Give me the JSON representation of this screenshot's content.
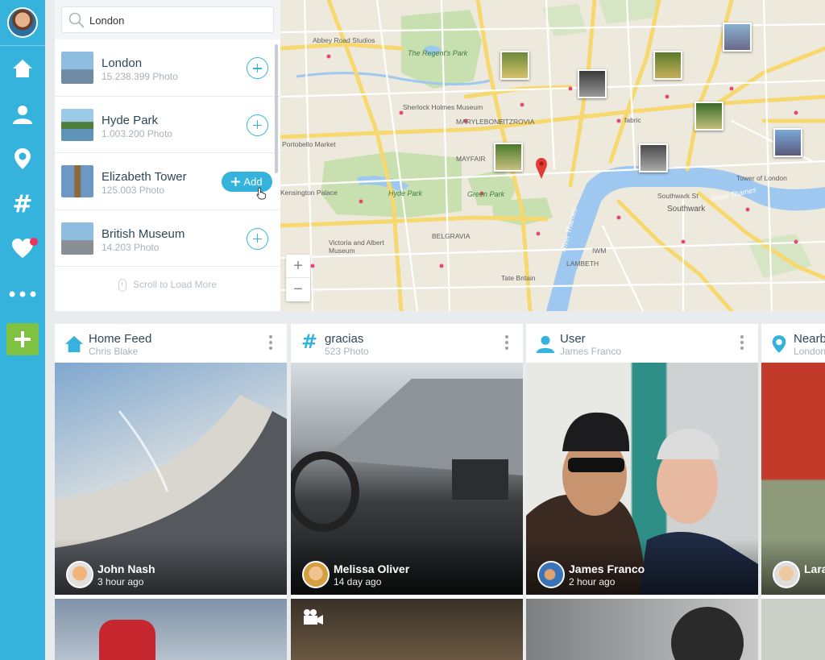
{
  "search": {
    "value": "London",
    "results": [
      {
        "title": "London",
        "count": "15.238.399 Photo"
      },
      {
        "title": "Hyde Park",
        "count": "1.003.200 Photo"
      },
      {
        "title": "Elizabeth Tower",
        "count": "125.003 Photo",
        "action": "Add"
      },
      {
        "title": "British Museum",
        "count": "14.203 Photo"
      }
    ],
    "load_more": "Scroll to Load More"
  },
  "map": {
    "labels": {
      "abbey": "Abbey Road Studios",
      "regents": "The Regent's Park",
      "marylebone": "MARYLEBONE",
      "fitzrovia": "FITZROVIA",
      "sherlock": "Sherlock Holmes Museum",
      "mayfair": "MAYFAIR",
      "hyde": "Hyde Park",
      "green": "Green Park",
      "kensington": "Kensington Palace",
      "belgravia": "BELGRAVIA",
      "va": "Victoria and Albert Museum",
      "lambeth": "LAMBETH",
      "tate": "Tate Britain",
      "southwark": "Southwark",
      "southwark_st": "Southwark St",
      "tower": "Tower of London",
      "river": "River Thames",
      "river2": "River Thames",
      "iwm": "IWM",
      "fabric": "fabric",
      "portobello": "Portobello Market"
    },
    "zoom_in": "+",
    "zoom_out": "−"
  },
  "feeds": [
    {
      "title": "Home Feed",
      "subtitle": "Chris Blake",
      "user": "John Nash",
      "time": "3 hour ago"
    },
    {
      "title": "gracias",
      "subtitle": "523 Photo",
      "user": "Melissa Oliver",
      "time": "14 day ago"
    },
    {
      "title": "User",
      "subtitle": "James Franco",
      "user": "James Franco",
      "time": "2 hour ago"
    },
    {
      "title": "Nearby",
      "subtitle": "London",
      "user": "Lara",
      "time": ""
    }
  ],
  "colors": {
    "accent": "#35b3dc",
    "sidebar": "#35b3dc",
    "add": "#7fc241",
    "notification": "#f0325f"
  }
}
